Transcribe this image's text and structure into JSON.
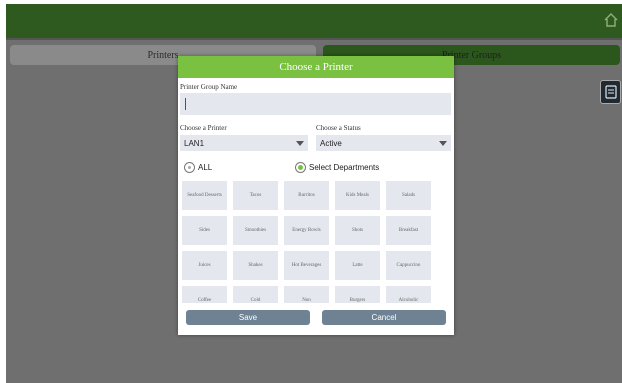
{
  "tabs": [
    "Printers",
    "Printer Groups"
  ],
  "modal": {
    "title": "Choose a Printer",
    "group_name_label": "Printer Group Name",
    "group_name_value": "",
    "printer_label": "Choose a Printer",
    "printer_value": "LAN1",
    "status_label": "Choose a Status",
    "status_value": "Active",
    "radio_all": "ALL",
    "radio_departments": "Select Departments",
    "selected_radio": "Select Departments",
    "departments": [
      "Seafood Desserts",
      "Tacos",
      "Burritos",
      "Kids Meals",
      "Salads",
      "Sides",
      "Smoothies",
      "Energy Bowls",
      "Shots",
      "Breakfast",
      "Juices",
      "Shakes",
      "Hot Beverages",
      "Latte",
      "Cappuccino",
      "Coffee",
      "Cold",
      "Non",
      "Burgers",
      "Alcoholic"
    ],
    "save_label": "Save",
    "cancel_label": "Cancel"
  },
  "colors": {
    "header_green": "#7ac142",
    "topbar_green": "#2e5a1f",
    "button_slate": "#6e8294",
    "overlay_gray": "#6f6f6f"
  },
  "icons": [
    "home-icon",
    "document-icon",
    "dropdown-arrow-icon"
  ]
}
